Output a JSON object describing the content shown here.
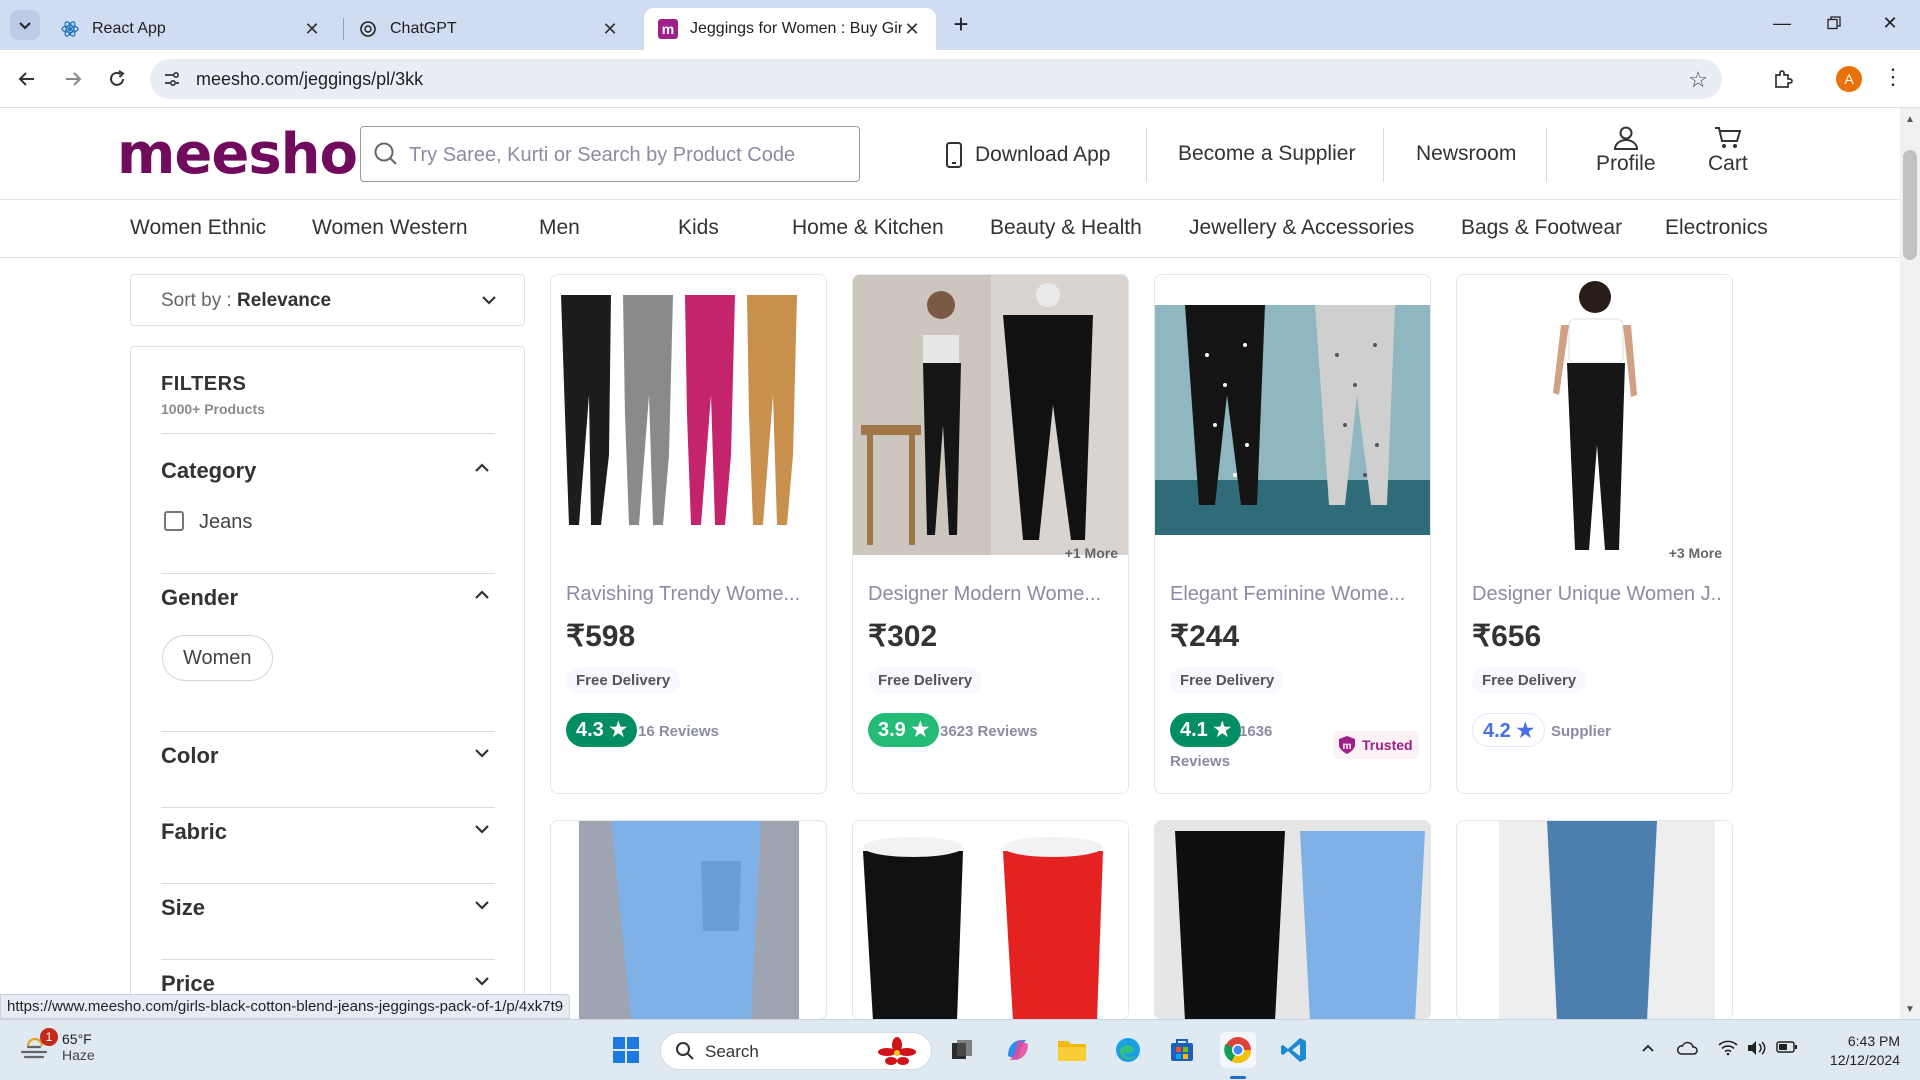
{
  "browser": {
    "tabs": [
      {
        "title": "React App",
        "active": false
      },
      {
        "title": "ChatGPT",
        "active": false
      },
      {
        "title": "Jeggings for Women : Buy Girls",
        "active": true
      }
    ],
    "url": "meesho.com/jeggings/pl/3kk",
    "profile_initial": "A",
    "status_url": "https://www.meesho.com/girls-black-cotton-blend-jeans-jeggings-pack-of-1/p/4xk7t9"
  },
  "header": {
    "logo": "meesho",
    "search_placeholder": "Try Saree, Kurti or Search by Product Code",
    "links": {
      "download_app": "Download App",
      "become_supplier": "Become a Supplier",
      "newsroom": "Newsroom",
      "profile": "Profile",
      "cart": "Cart"
    }
  },
  "categories": [
    "Women Ethnic",
    "Women Western",
    "Men",
    "Kids",
    "Home & Kitchen",
    "Beauty & Health",
    "Jewellery & Accessories",
    "Bags & Footwear",
    "Electronics"
  ],
  "sort": {
    "label": "Sort by :",
    "value": "Relevance"
  },
  "filters": {
    "title": "FILTERS",
    "count": "1000+ Products",
    "category": {
      "heading": "Category",
      "options": [
        "Jeans"
      ]
    },
    "gender": {
      "heading": "Gender",
      "options": [
        "Women"
      ]
    },
    "color": "Color",
    "fabric": "Fabric",
    "size": "Size",
    "price": "Price"
  },
  "products": [
    {
      "name": "Ravishing Trendy Wome...",
      "price": "₹598",
      "delivery": "Free Delivery",
      "rating": "4.3",
      "rating_color": "#038d63",
      "reviews": "16 Reviews",
      "more": "",
      "image_code": "s-273732276"
    },
    {
      "name": "Designer Modern Wome...",
      "price": "₹302",
      "delivery": "Free Delivery",
      "rating": "3.9",
      "rating_color": "#23bb75",
      "reviews": "3623 Reviews",
      "more": "+1 More",
      "image_code": "s-298235277"
    },
    {
      "name": "Elegant Feminine Wome...",
      "price": "₹244",
      "delivery": "Free Delivery",
      "rating": "4.1",
      "rating_color": "#038d63",
      "reviews": "1636",
      "reviews2": "Reviews",
      "trusted": "Trusted",
      "more": "",
      "image_code": "s-107652327"
    },
    {
      "name": "Designer Unique Women J...",
      "price": "₹656",
      "delivery": "Free Delivery",
      "rating": "4.2",
      "rating_color": "#4a6fe0",
      "reviews": "Supplier",
      "more": "+3 More",
      "image_code": "s-461564303"
    }
  ],
  "taskbar": {
    "weather_temp": "65°F",
    "weather_desc": "Haze",
    "weather_badge": "1",
    "search_label": "Search",
    "time": "6:43 PM",
    "date": "12/12/2024"
  }
}
